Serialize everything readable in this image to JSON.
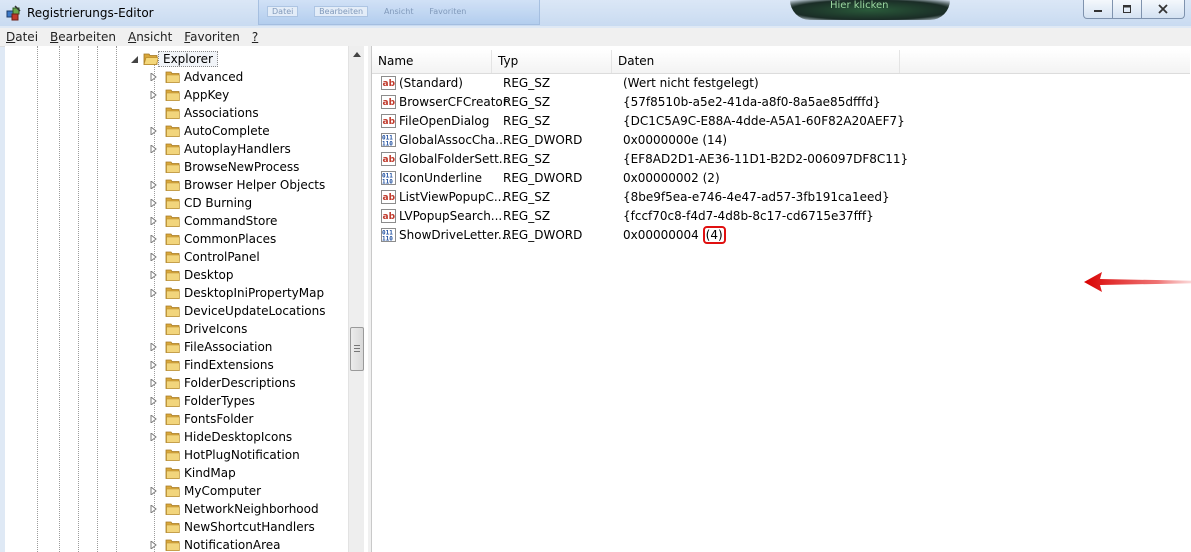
{
  "window": {
    "title": "Registrierungs-Editor",
    "background_tabs": [
      "Datei",
      "Bearbeiten",
      "Ansicht",
      "Favoriten"
    ],
    "background_ad": "Hier klicken"
  },
  "menu": [
    {
      "first": "D",
      "rest": "atei"
    },
    {
      "first": "B",
      "rest": "earbeiten"
    },
    {
      "first": "A",
      "rest": "nsicht"
    },
    {
      "first": "F",
      "rest": "avoriten"
    },
    {
      "first": "?",
      "rest": ""
    }
  ],
  "tree": {
    "selected": "Explorer",
    "children": [
      {
        "label": "Advanced",
        "expandable": true
      },
      {
        "label": "AppKey",
        "expandable": true
      },
      {
        "label": "Associations",
        "expandable": false
      },
      {
        "label": "AutoComplete",
        "expandable": true
      },
      {
        "label": "AutoplayHandlers",
        "expandable": true
      },
      {
        "label": "BrowseNewProcess",
        "expandable": false
      },
      {
        "label": "Browser Helper Objects",
        "expandable": true
      },
      {
        "label": "CD Burning",
        "expandable": true
      },
      {
        "label": "CommandStore",
        "expandable": true
      },
      {
        "label": "CommonPlaces",
        "expandable": true
      },
      {
        "label": "ControlPanel",
        "expandable": true
      },
      {
        "label": "Desktop",
        "expandable": true
      },
      {
        "label": "DesktopIniPropertyMap",
        "expandable": true
      },
      {
        "label": "DeviceUpdateLocations",
        "expandable": false
      },
      {
        "label": "DriveIcons",
        "expandable": false
      },
      {
        "label": "FileAssociation",
        "expandable": true
      },
      {
        "label": "FindExtensions",
        "expandable": true
      },
      {
        "label": "FolderDescriptions",
        "expandable": true
      },
      {
        "label": "FolderTypes",
        "expandable": true
      },
      {
        "label": "FontsFolder",
        "expandable": true
      },
      {
        "label": "HideDesktopIcons",
        "expandable": true
      },
      {
        "label": "HotPlugNotification",
        "expandable": false
      },
      {
        "label": "KindMap",
        "expandable": false
      },
      {
        "label": "MyComputer",
        "expandable": true
      },
      {
        "label": "NetworkNeighborhood",
        "expandable": true
      },
      {
        "label": "NewShortcutHandlers",
        "expandable": false
      },
      {
        "label": "NotificationArea",
        "expandable": true
      }
    ]
  },
  "list": {
    "columns": [
      "Name",
      "Typ",
      "Daten"
    ],
    "rows": [
      {
        "icon": "string-value-icon",
        "name": "(Standard)",
        "type": "REG_SZ",
        "data": "(Wert nicht festgelegt)"
      },
      {
        "icon": "string-value-icon",
        "name": "BrowserCFCreator",
        "type": "REG_SZ",
        "data": "{57f8510b-a5e2-41da-a8f0-8a5ae85dfffd}"
      },
      {
        "icon": "string-value-icon",
        "name": "FileOpenDialog",
        "type": "REG_SZ",
        "data": "{DC1C5A9C-E88A-4dde-A5A1-60F82A20AEF7}"
      },
      {
        "icon": "binary-value-icon",
        "name": "GlobalAssocCha...",
        "type": "REG_DWORD",
        "data": "0x0000000e (14)"
      },
      {
        "icon": "string-value-icon",
        "name": "GlobalFolderSett...",
        "type": "REG_SZ",
        "data": "{EF8AD2D1-AE36-11D1-B2D2-006097DF8C11}"
      },
      {
        "icon": "binary-value-icon",
        "name": "IconUnderline",
        "type": "REG_DWORD",
        "data": "0x00000002 (2)"
      },
      {
        "icon": "string-value-icon",
        "name": "ListViewPopupC...",
        "type": "REG_SZ",
        "data": "{8be9f5ea-e746-4e47-ad57-3fb191ca1eed}"
      },
      {
        "icon": "string-value-icon",
        "name": "LVPopupSearch...",
        "type": "REG_SZ",
        "data": "{fccf70c8-f4d7-4d8b-8c17-cd6715e37fff}"
      },
      {
        "icon": "binary-value-icon",
        "name": "ShowDriveLetter...",
        "type": "REG_DWORD",
        "data_main": "0x00000004 ",
        "data_highlight": "(4)"
      }
    ]
  },
  "colors": {
    "annotation": "#e01010",
    "folder": "#e8c45c"
  }
}
